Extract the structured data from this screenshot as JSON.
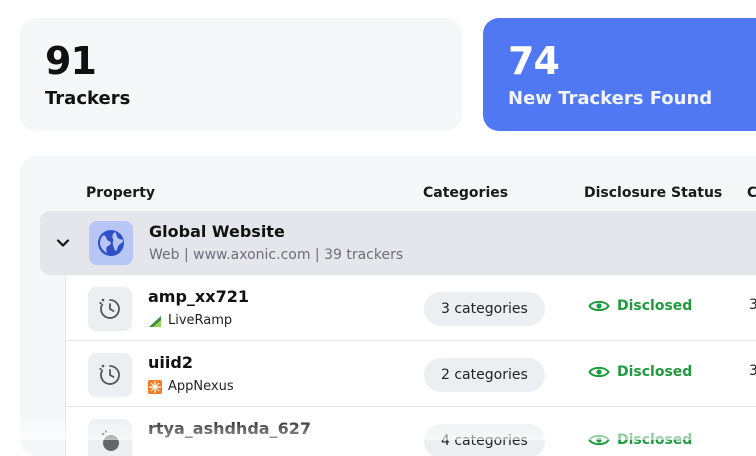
{
  "stats": {
    "trackers": {
      "value": "91",
      "label": "Trackers"
    },
    "new_trackers": {
      "value": "74",
      "label": "New Trackers Found"
    }
  },
  "table": {
    "columns": {
      "property": "Property",
      "categories": "Categories",
      "disclosure": "Disclosure Status",
      "next_truncated": "C"
    },
    "group": {
      "title": "Global Website",
      "subtitle": "Web | www.axonic.com | 39 trackers",
      "icon": "globe-icon",
      "expanded": true
    },
    "rows": [
      {
        "name": "amp_xx721",
        "vendor": "LiveRamp",
        "vendor_icon": "liveramp-logo",
        "categories": "3 categories",
        "status": "Disclosed",
        "trail": "3"
      },
      {
        "name": "uiid2",
        "vendor": "AppNexus",
        "vendor_icon": "appnexus-logo",
        "categories": "2 categories",
        "status": "Disclosed",
        "trail": "3"
      },
      {
        "name": "rtya_ashdhda_627",
        "vendor": "",
        "vendor_icon": "",
        "categories": "4 categories",
        "status": "Disclosed",
        "trail": ""
      }
    ]
  },
  "colors": {
    "accent_blue": "#5078f2",
    "disclosed_green": "#1e9b3f",
    "panel_bg": "#f6f7f9",
    "group_bg": "#e4e6ec"
  }
}
